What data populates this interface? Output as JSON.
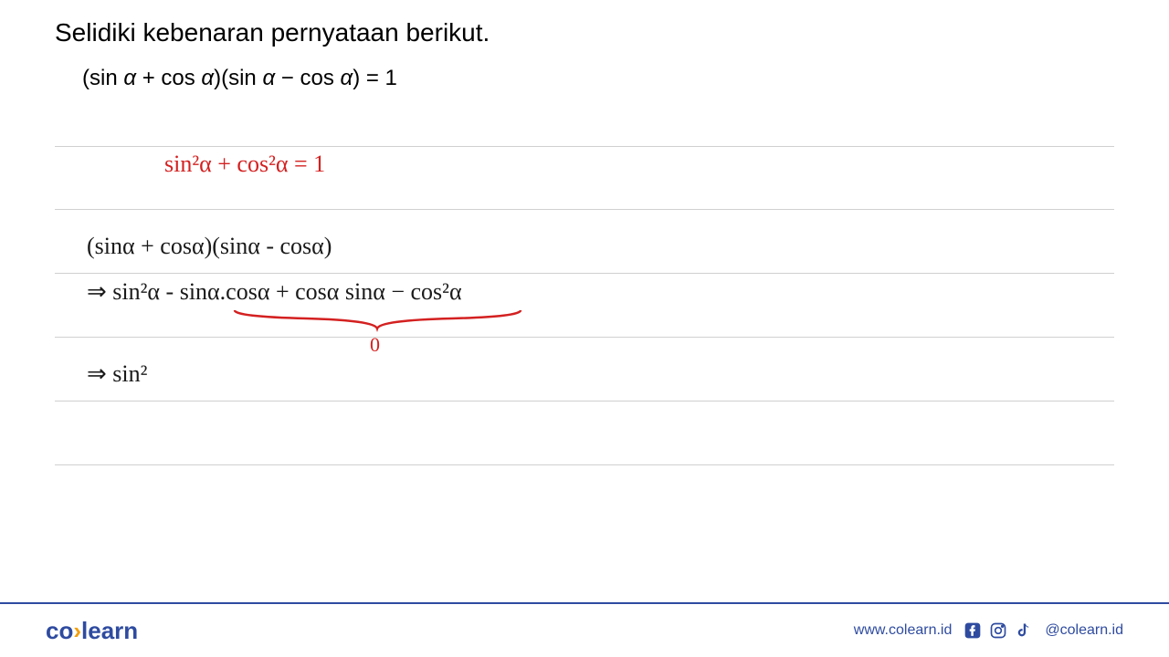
{
  "problem": {
    "title": "Selidiki kebenaran pernyataan berikut.",
    "equation": "(sin α + cos α)(sin α − cos α) = 1"
  },
  "handwritten": {
    "identity": "sin²α + cos²α = 1",
    "expansion_line1": "(sinα + cosα)(sinα - cosα)",
    "expansion_line2": "⇒ sin²α - sinα.cosα + cosα sinα − cos²α",
    "brace_result": "0",
    "expansion_line3": "⇒ sin²"
  },
  "footer": {
    "logo_part1": "co",
    "logo_sep": "›",
    "logo_part2": "learn",
    "website": "www.colearn.id",
    "handle": "@colearn.id"
  }
}
